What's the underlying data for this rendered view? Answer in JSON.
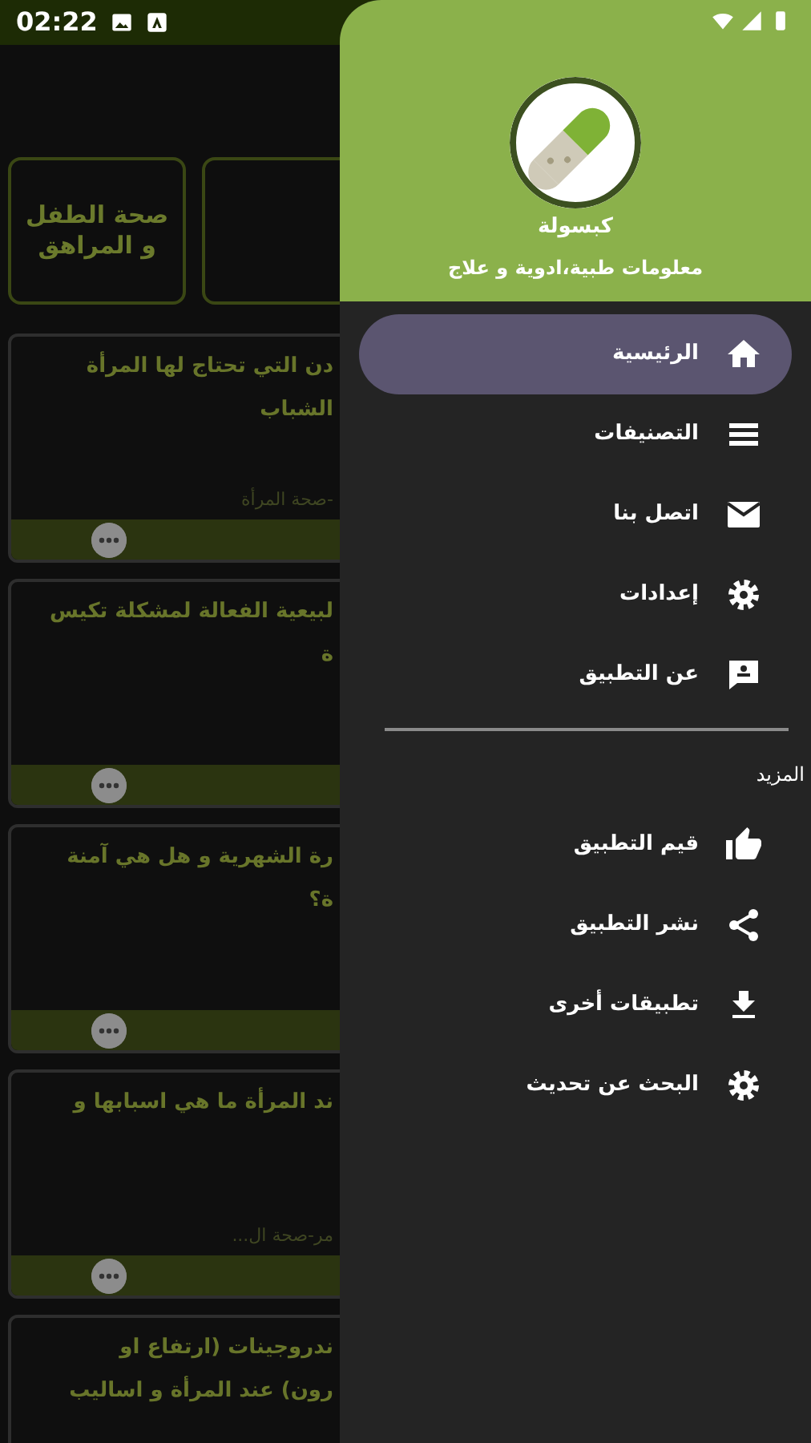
{
  "status_bar": {
    "time": "02:22"
  },
  "category_tiles": [
    {
      "label": "صحة الطفل و المراهق"
    }
  ],
  "articles": [
    {
      "title_lines": [
        "دن التي تحتاج لها المرأة",
        "الشباب"
      ],
      "meta": "-صحة المرأة"
    },
    {
      "title_lines": [
        "لبيعية الفعالة لمشكلة تكيس",
        "ة"
      ]
    },
    {
      "title_lines": [
        "رة الشهرية و هل هي آمنة",
        "ة؟"
      ]
    },
    {
      "title_lines": [
        "ند المرأة ما هي اسبابها و"
      ],
      "meta": "مر-صحة ال..."
    },
    {
      "title_lines": [
        "ندروجينات (ارتفاع او",
        "رون) عند المرأة و اساليب"
      ]
    }
  ],
  "drawer": {
    "app_name": "كبسولة",
    "tagline": "معلومات طبية،ادوية و علاج",
    "items": [
      {
        "label": "الرئيسية",
        "selected": true
      },
      {
        "label": "التصنيفات",
        "selected": false
      },
      {
        "label": "اتصل بنا",
        "selected": false
      },
      {
        "label": "إعدادات",
        "selected": false
      },
      {
        "label": "عن التطبيق",
        "selected": false
      }
    ],
    "section_title": "المزيد",
    "more_items": [
      {
        "label": "قيم التطبيق"
      },
      {
        "label": "نشر التطبيق"
      },
      {
        "label": "تطبيقات أخرى"
      },
      {
        "label": "البحث عن تحديث"
      }
    ]
  }
}
